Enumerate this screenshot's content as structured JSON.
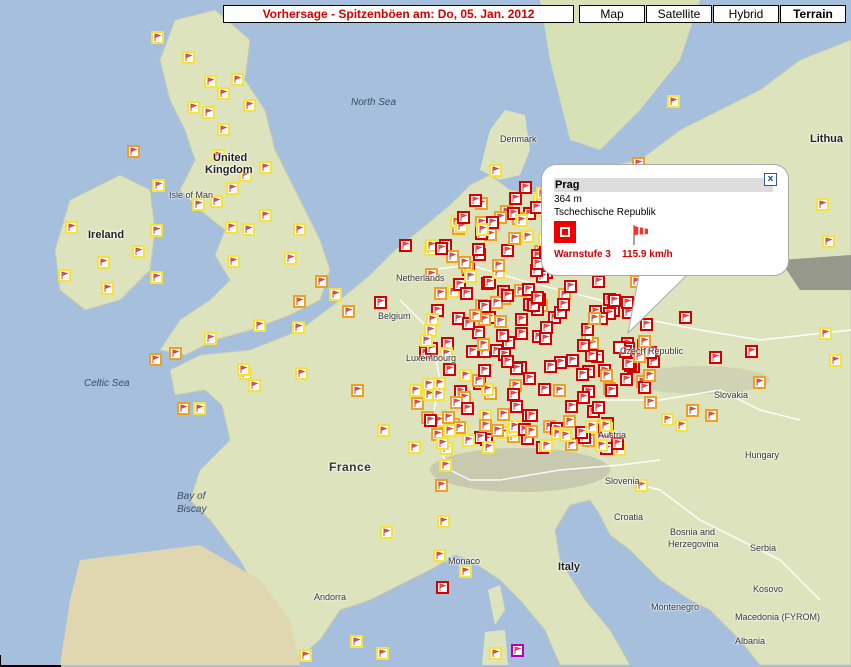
{
  "title": "Vorhersage - Spitzenböen am: Do, 05. Jan. 2012",
  "map_types": [
    {
      "label": "Map",
      "active": false
    },
    {
      "label": "Satellite",
      "active": false
    },
    {
      "label": "Hybrid",
      "active": false
    },
    {
      "label": "Terrain",
      "active": true
    }
  ],
  "labels": {
    "north_sea": "North Sea",
    "denmark": "Denmark",
    "lithuania": "Lithua",
    "united_kingdom_1": "United",
    "united_kingdom_2": "Kingdom",
    "isle_of_man": "Isle of Man",
    "ireland": "Ireland",
    "netherlands": "Netherlands",
    "belgium": "Belgium",
    "luxembourg": "Luxembourg",
    "czech_republic": "Czech Republic",
    "celtic_sea": "Celtic Sea",
    "slovakia": "Slovakia",
    "austria": "Austria",
    "hungary": "Hungary",
    "france": "France",
    "slovenia": "Slovenia",
    "croatia": "Croatia",
    "bay_1": "Bay of",
    "bay_2": "Biscay",
    "bosnia_1": "Bosnia and",
    "bosnia_2": "Herzegovina",
    "serbia": "Serbia",
    "monaco": "Monaco",
    "italy": "Italy",
    "andorra": "Andorra",
    "kosovo": "Kosovo",
    "montenegro": "Montenegro",
    "macedonia": "Macedonia (FYROM)",
    "albania": "Albania"
  },
  "popup": {
    "station": "Prag",
    "elevation": "364 m",
    "country": "Tschechische Republik",
    "warn_level": "Warnstufe 3",
    "gust": "115.9  km/h",
    "close_symbol": "x"
  },
  "colors": {
    "level1": "#f5e23a",
    "level2": "#f0a020",
    "level3": "#d40000",
    "special": "#b000c0",
    "land": "#dfe6c0",
    "sea": "#a5bfdd"
  },
  "icons": {
    "marker": "flag-icon",
    "close": "close-icon"
  }
}
